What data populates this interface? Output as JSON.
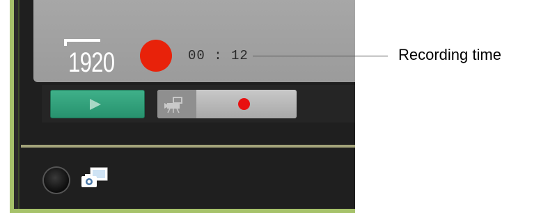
{
  "display": {
    "resolution_label": "1920",
    "record_indicator_color": "#e8220a",
    "recording_time": "00 : 12"
  },
  "controls": {
    "play_button_icon": "play-icon",
    "movie_record_button_icon": "movie-camera-icon",
    "record_dot_color": "#e81010"
  },
  "bottom": {
    "knob_icon": "dial-knob-icon",
    "live_view_icon": "live-view-icon"
  },
  "annotation": {
    "callout_label": "Recording time"
  },
  "colors": {
    "frame_border": "#a6c26a",
    "panel_gray": "#a0a0a0",
    "play_green": "#2f9f7a"
  }
}
